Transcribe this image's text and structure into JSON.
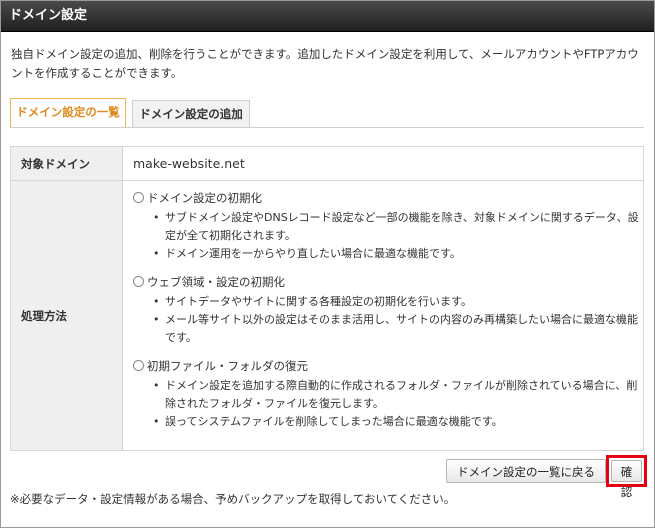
{
  "window": {
    "title": "ドメイン設定"
  },
  "description": "独自ドメイン設定の追加、削除を行うことができます。追加したドメイン設定を利用して、メールアカウントやFTPアカウントを作成することができます。",
  "tabs": [
    {
      "label": "ドメイン設定の一覧",
      "active": true
    },
    {
      "label": "ドメイン設定の追加",
      "active": false
    }
  ],
  "form": {
    "domain_label": "対象ドメイン",
    "domain_value": "make-website.net",
    "method_label": "処理方法",
    "options": [
      {
        "label": "ドメイン設定の初期化",
        "notes": [
          "サブドメイン設定やDNSレコード設定など一部の機能を除き、対象ドメインに関するデータ、設定が全て初期化されます。",
          "ドメイン運用を一からやり直したい場合に最適な機能です。"
        ]
      },
      {
        "label": "ウェブ領域・設定の初期化",
        "notes": [
          "サイトデータやサイトに関する各種設定の初期化を行います。",
          "メール等サイト以外の設定はそのまま活用し、サイトの内容のみ再構築したい場合に最適な機能です。"
        ]
      },
      {
        "label": "初期ファイル・フォルダの復元",
        "notes": [
          "ドメイン設定を追加する際自動的に作成されるフォルダ・ファイルが削除されている場合に、削除されたフォルダ・ファイルを復元します。",
          "誤ってシステムファイルを削除してしまった場合に最適な機能です。"
        ]
      }
    ]
  },
  "buttons": {
    "back": "ドメイン設定の一覧に戻る",
    "confirm": "確認"
  },
  "footnote": "※必要なデータ・設定情報がある場合、予めバックアップを取得しておいてください。",
  "colors": {
    "highlight": "#e60012",
    "active_tab": "#e08a1e"
  }
}
